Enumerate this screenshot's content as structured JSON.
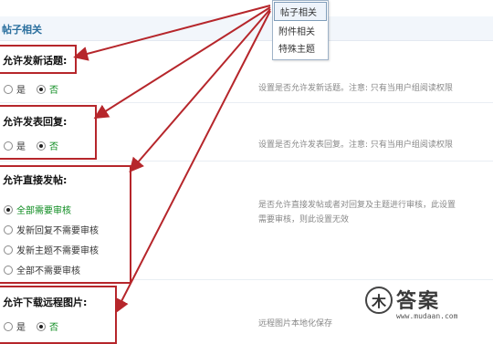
{
  "section": {
    "title": "帖子相关"
  },
  "dropdown": {
    "items": [
      "帖子相关",
      "附件相关",
      "特殊主题"
    ]
  },
  "settings": {
    "new_topic": {
      "title": "允许发新话题:",
      "options": [
        "是",
        "否"
      ],
      "selected": "否",
      "description": "设置是否允许发新话题。注意: 只有当用户组阅读权限"
    },
    "reply": {
      "title": "允许发表回复:",
      "options": [
        "是",
        "否"
      ],
      "selected": "否",
      "description": "设置是否允许发表回复。注意: 只有当用户组阅读权限"
    },
    "direct_post": {
      "title": "允许直接发帖:",
      "options": [
        "全部需要审核",
        "发新回复不需要审核",
        "发新主题不需要审核",
        "全部不需要审核"
      ],
      "selected": "全部需要审核",
      "description_line1": "是否允许直接发帖或者对回复及主题进行审核，此设置",
      "description_line2": "需要审核，则此设置无效"
    },
    "remote_images": {
      "title": "允许下载远程图片:",
      "options": [
        "是",
        "否"
      ],
      "selected": "否",
      "description": "远程图片本地化保存"
    }
  },
  "watermark": {
    "logo_glyph": "木",
    "text": "答案",
    "url": "www.mudaan.com"
  },
  "colors": {
    "accent_red": "#b6262b",
    "selected_green": "#0a8a1d",
    "header_blue": "#2a6f9e"
  }
}
